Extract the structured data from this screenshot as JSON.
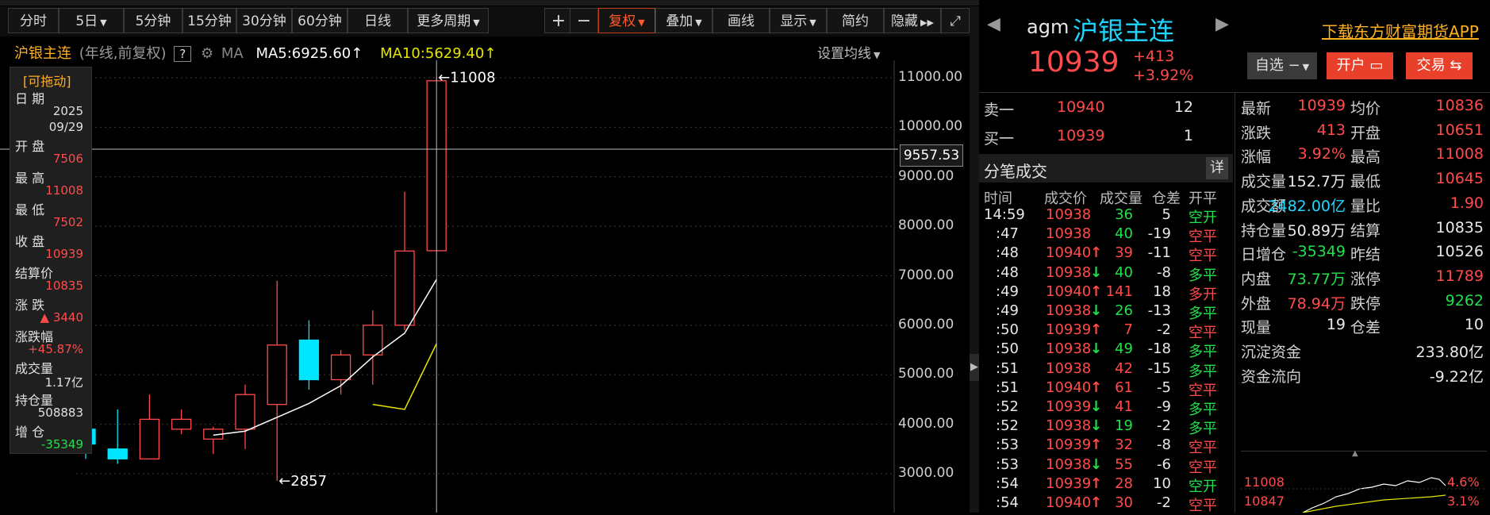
{
  "toolbar": {
    "items": [
      "分时",
      "5日",
      "5分钟",
      "15分钟",
      "30分钟",
      "60分钟",
      "日线",
      "更多周期",
      "复权",
      "叠加",
      "画线",
      "显示",
      "简约",
      "隐藏"
    ],
    "plus": "+",
    "minus": "−"
  },
  "info": {
    "name": "沪银主连",
    "mode": "(年线,前复权)",
    "help": "?",
    "ma_label": "MA",
    "ma5": "MA5:6925.60",
    "ma10": "MA10:5629.40",
    "settings": "设置均线"
  },
  "left_panel": {
    "drag": "[可拖动]",
    "rows": [
      {
        "label": "日 期",
        "value": "2025"
      },
      {
        "label": "",
        "value": "09/29"
      },
      {
        "label": "开 盘",
        "value": "7506"
      },
      {
        "label": "最 高",
        "value": "11008"
      },
      {
        "label": "最 低",
        "value": "7502"
      },
      {
        "label": "收 盘",
        "value": "10939"
      },
      {
        "label": "结算价",
        "value": "10835"
      },
      {
        "label": "涨 跌",
        "value": "▲ 3440"
      },
      {
        "label": "涨跌幅",
        "value": "+45.87%"
      },
      {
        "label": "成交量",
        "value": "1.17亿"
      },
      {
        "label": "持仓量",
        "value": "508883"
      },
      {
        "label": "增 仓",
        "value": "-35349"
      }
    ]
  },
  "chart_data": {
    "type": "candlestick",
    "y_ticks": [
      "11000.00",
      "10000.00",
      "9000.00",
      "8000.00",
      "7000.00",
      "6000.00",
      "5000.00",
      "4000.00",
      "3000.00"
    ],
    "crosshair_value": "9557.53",
    "annotations": {
      "high": "11008",
      "low": "2857"
    },
    "candles": [
      {
        "open": 3900,
        "close": 3600,
        "high": 4200,
        "low": 3300
      },
      {
        "open": 3500,
        "close": 3300,
        "high": 4300,
        "low": 3200
      },
      {
        "open": 3300,
        "close": 4100,
        "high": 4600,
        "low": 3300
      },
      {
        "open": 3900,
        "close": 4100,
        "high": 4300,
        "low": 3800
      },
      {
        "open": 3700,
        "close": 3900,
        "high": 3950,
        "low": 3400
      },
      {
        "open": 3900,
        "close": 4600,
        "high": 4800,
        "low": 3500
      },
      {
        "open": 4400,
        "close": 5600,
        "high": 6900,
        "low": 2857
      },
      {
        "open": 5700,
        "close": 4900,
        "high": 6100,
        "low": 4700
      },
      {
        "open": 4900,
        "close": 5400,
        "high": 5500,
        "low": 4600
      },
      {
        "open": 5400,
        "close": 6000,
        "high": 6300,
        "low": 4800
      },
      {
        "open": 6000,
        "close": 7500,
        "high": 8700,
        "low": 5900
      },
      {
        "open": 7506,
        "close": 10939,
        "high": 11008,
        "low": 7502
      }
    ],
    "ma5": [
      null,
      null,
      null,
      null,
      3780,
      3860,
      4140,
      4420,
      4780,
      5360,
      5840,
      6925.6
    ],
    "ma10": [
      null,
      null,
      null,
      null,
      null,
      null,
      null,
      null,
      null,
      4400,
      4300,
      5629.4
    ],
    "ylim": [
      2800,
      11250
    ]
  },
  "quote": {
    "code": "agm",
    "name": "沪银主连",
    "price": "10939",
    "change": "+413",
    "change_pct": "+3.92%",
    "download": "下载东方财富期货APP",
    "watch_btn": "自选",
    "open_btn": "开户",
    "trade_btn": "交易"
  },
  "orderbook": {
    "sell": {
      "label": "卖一",
      "price": "10940",
      "vol": "12"
    },
    "buy": {
      "label": "买一",
      "price": "10939",
      "vol": "1"
    }
  },
  "ticks": {
    "title": "分笔成交",
    "detail": "详",
    "headers": [
      "时间",
      "成交价",
      "成交量",
      "仓差",
      "开平"
    ],
    "rows": [
      {
        "t": "14:59",
        "p": "10938",
        "a": "",
        "v": "36",
        "d": "5",
        "k": "空开",
        "kc": "green"
      },
      {
        "t": ":47",
        "p": "10938",
        "a": "",
        "v": "40",
        "d": "-19",
        "k": "空平",
        "kc": "red"
      },
      {
        "t": ":48",
        "p": "10940",
        "a": "up",
        "v": "39",
        "d": "-11",
        "k": "空平",
        "kc": "red"
      },
      {
        "t": ":48",
        "p": "10938",
        "a": "down",
        "v": "40",
        "d": "-8",
        "k": "多平",
        "kc": "green"
      },
      {
        "t": ":49",
        "p": "10940",
        "a": "up",
        "v": "141",
        "d": "18",
        "k": "多开",
        "kc": "red"
      },
      {
        "t": ":49",
        "p": "10938",
        "a": "down",
        "v": "26",
        "d": "-13",
        "k": "多平",
        "kc": "green"
      },
      {
        "t": ":50",
        "p": "10939",
        "a": "up",
        "v": "7",
        "d": "-2",
        "k": "空平",
        "kc": "red"
      },
      {
        "t": ":50",
        "p": "10938",
        "a": "down",
        "v": "49",
        "d": "-18",
        "k": "多平",
        "kc": "green"
      },
      {
        "t": ":51",
        "p": "10938",
        "a": "",
        "v": "42",
        "d": "-15",
        "k": "多平",
        "kc": "green"
      },
      {
        "t": ":51",
        "p": "10940",
        "a": "up",
        "v": "61",
        "d": "-5",
        "k": "空平",
        "kc": "red"
      },
      {
        "t": ":52",
        "p": "10939",
        "a": "down",
        "v": "41",
        "d": "-9",
        "k": "多平",
        "kc": "green"
      },
      {
        "t": ":52",
        "p": "10938",
        "a": "down",
        "v": "19",
        "d": "-2",
        "k": "多平",
        "kc": "green"
      },
      {
        "t": ":53",
        "p": "10939",
        "a": "up",
        "v": "32",
        "d": "-8",
        "k": "空平",
        "kc": "red"
      },
      {
        "t": ":53",
        "p": "10938",
        "a": "down",
        "v": "55",
        "d": "-6",
        "k": "空平",
        "kc": "red"
      },
      {
        "t": ":54",
        "p": "10939",
        "a": "up",
        "v": "28",
        "d": "10",
        "k": "空开",
        "kc": "green"
      },
      {
        "t": ":54",
        "p": "10940",
        "a": "up",
        "v": "30",
        "d": "-2",
        "k": "空平",
        "kc": "red"
      }
    ]
  },
  "stats": {
    "rows": [
      [
        {
          "l": "最新",
          "v": "10939",
          "c": "red"
        },
        {
          "l": "均价",
          "v": "10836",
          "c": "red"
        }
      ],
      [
        {
          "l": "涨跌",
          "v": "413",
          "c": "red"
        },
        {
          "l": "开盘",
          "v": "10651",
          "c": "red"
        }
      ],
      [
        {
          "l": "涨幅",
          "v": "3.92%",
          "c": "red"
        },
        {
          "l": "最高",
          "v": "11008",
          "c": "red"
        }
      ],
      [
        {
          "l": "成交量",
          "v": "152.7万",
          "c": "white"
        },
        {
          "l": "最低",
          "v": "10645",
          "c": "red"
        }
      ],
      [
        {
          "l": "成交额",
          "v": "2482.00亿",
          "c": "cyan"
        },
        {
          "l": "量比",
          "v": "1.90",
          "c": "red"
        }
      ],
      [
        {
          "l": "持仓量",
          "v": "50.89万",
          "c": "white"
        },
        {
          "l": "结算",
          "v": "10835",
          "c": "white"
        }
      ],
      [
        {
          "l": "日增仓",
          "v": "-35349",
          "c": "green"
        },
        {
          "l": "昨结",
          "v": "10526",
          "c": "white"
        }
      ],
      [
        {
          "l": "内盘",
          "v": "73.77万",
          "c": "green"
        },
        {
          "l": "涨停",
          "v": "11789",
          "c": "red"
        }
      ],
      [
        {
          "l": "外盘",
          "v": "78.94万",
          "c": "red"
        },
        {
          "l": "跌停",
          "v": "9262",
          "c": "green"
        }
      ],
      [
        {
          "l": "现量",
          "v": "19",
          "c": "white"
        },
        {
          "l": "仓差",
          "v": "10",
          "c": "white"
        }
      ]
    ],
    "fund_label": "沉淀资金",
    "fund_value": "233.80亿",
    "flow_label": "资金流向",
    "flow_value": "-9.22亿"
  },
  "mini": {
    "high": "11008",
    "low": "10847",
    "high_pct": "4.6%",
    "low_pct": "3.1%"
  },
  "colors": {
    "up": "#ff4b4b",
    "down": "#00e5ff",
    "ma5": "#ffffff",
    "ma10": "#e6e600",
    "green": "#21e14b"
  }
}
